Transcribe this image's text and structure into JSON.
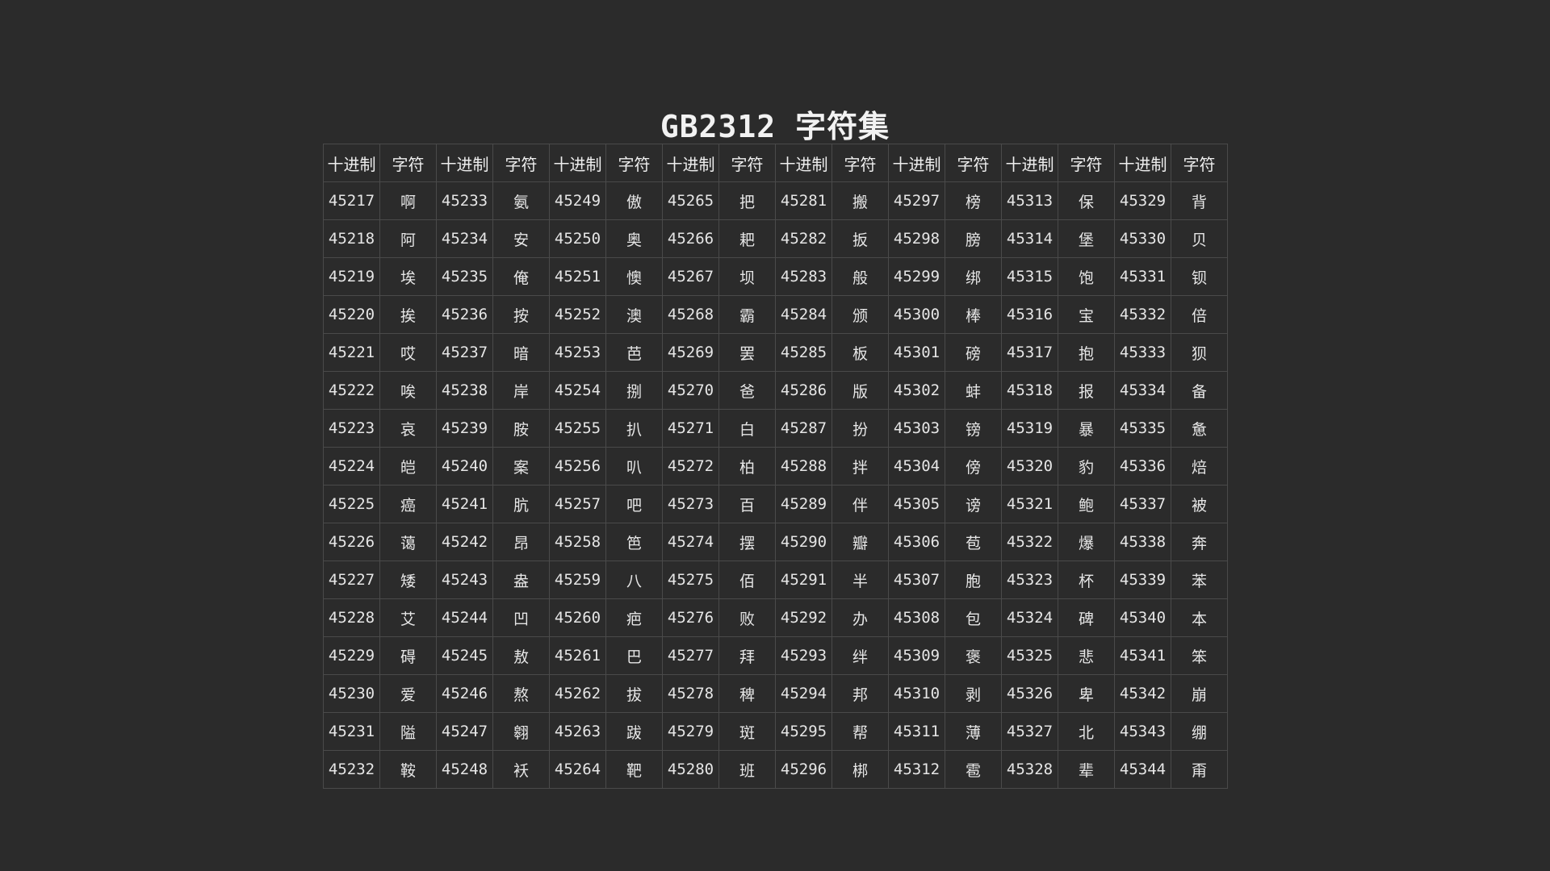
{
  "title": "GB2312 字符集",
  "headers": [
    "十进制",
    "字符",
    "十进制",
    "字符",
    "十进制",
    "字符",
    "十进制",
    "字符",
    "十进制",
    "字符",
    "十进制",
    "字符",
    "十进制",
    "字符",
    "十进制",
    "字符"
  ],
  "rows": [
    [
      "45217",
      "啊",
      "45233",
      "氨",
      "45249",
      "傲",
      "45265",
      "把",
      "45281",
      "搬",
      "45297",
      "榜",
      "45313",
      "保",
      "45329",
      "背"
    ],
    [
      "45218",
      "阿",
      "45234",
      "安",
      "45250",
      "奥",
      "45266",
      "耙",
      "45282",
      "扳",
      "45298",
      "膀",
      "45314",
      "堡",
      "45330",
      "贝"
    ],
    [
      "45219",
      "埃",
      "45235",
      "俺",
      "45251",
      "懊",
      "45267",
      "坝",
      "45283",
      "般",
      "45299",
      "绑",
      "45315",
      "饱",
      "45331",
      "钡"
    ],
    [
      "45220",
      "挨",
      "45236",
      "按",
      "45252",
      "澳",
      "45268",
      "霸",
      "45284",
      "颁",
      "45300",
      "棒",
      "45316",
      "宝",
      "45332",
      "倍"
    ],
    [
      "45221",
      "哎",
      "45237",
      "暗",
      "45253",
      "芭",
      "45269",
      "罢",
      "45285",
      "板",
      "45301",
      "磅",
      "45317",
      "抱",
      "45333",
      "狈"
    ],
    [
      "45222",
      "唉",
      "45238",
      "岸",
      "45254",
      "捌",
      "45270",
      "爸",
      "45286",
      "版",
      "45302",
      "蚌",
      "45318",
      "报",
      "45334",
      "备"
    ],
    [
      "45223",
      "哀",
      "45239",
      "胺",
      "45255",
      "扒",
      "45271",
      "白",
      "45287",
      "扮",
      "45303",
      "镑",
      "45319",
      "暴",
      "45335",
      "惫"
    ],
    [
      "45224",
      "皑",
      "45240",
      "案",
      "45256",
      "叭",
      "45272",
      "柏",
      "45288",
      "拌",
      "45304",
      "傍",
      "45320",
      "豹",
      "45336",
      "焙"
    ],
    [
      "45225",
      "癌",
      "45241",
      "肮",
      "45257",
      "吧",
      "45273",
      "百",
      "45289",
      "伴",
      "45305",
      "谤",
      "45321",
      "鲍",
      "45337",
      "被"
    ],
    [
      "45226",
      "蔼",
      "45242",
      "昂",
      "45258",
      "笆",
      "45274",
      "摆",
      "45290",
      "瓣",
      "45306",
      "苞",
      "45322",
      "爆",
      "45338",
      "奔"
    ],
    [
      "45227",
      "矮",
      "45243",
      "盎",
      "45259",
      "八",
      "45275",
      "佰",
      "45291",
      "半",
      "45307",
      "胞",
      "45323",
      "杯",
      "45339",
      "苯"
    ],
    [
      "45228",
      "艾",
      "45244",
      "凹",
      "45260",
      "疤",
      "45276",
      "败",
      "45292",
      "办",
      "45308",
      "包",
      "45324",
      "碑",
      "45340",
      "本"
    ],
    [
      "45229",
      "碍",
      "45245",
      "敖",
      "45261",
      "巴",
      "45277",
      "拜",
      "45293",
      "绊",
      "45309",
      "褒",
      "45325",
      "悲",
      "45341",
      "笨"
    ],
    [
      "45230",
      "爱",
      "45246",
      "熬",
      "45262",
      "拔",
      "45278",
      "稗",
      "45294",
      "邦",
      "45310",
      "剥",
      "45326",
      "卑",
      "45342",
      "崩"
    ],
    [
      "45231",
      "隘",
      "45247",
      "翱",
      "45263",
      "跋",
      "45279",
      "斑",
      "45295",
      "帮",
      "45311",
      "薄",
      "45327",
      "北",
      "45343",
      "绷"
    ],
    [
      "45232",
      "鞍",
      "45248",
      "袄",
      "45264",
      "靶",
      "45280",
      "班",
      "45296",
      "梆",
      "45312",
      "雹",
      "45328",
      "辈",
      "45344",
      "甭"
    ]
  ]
}
